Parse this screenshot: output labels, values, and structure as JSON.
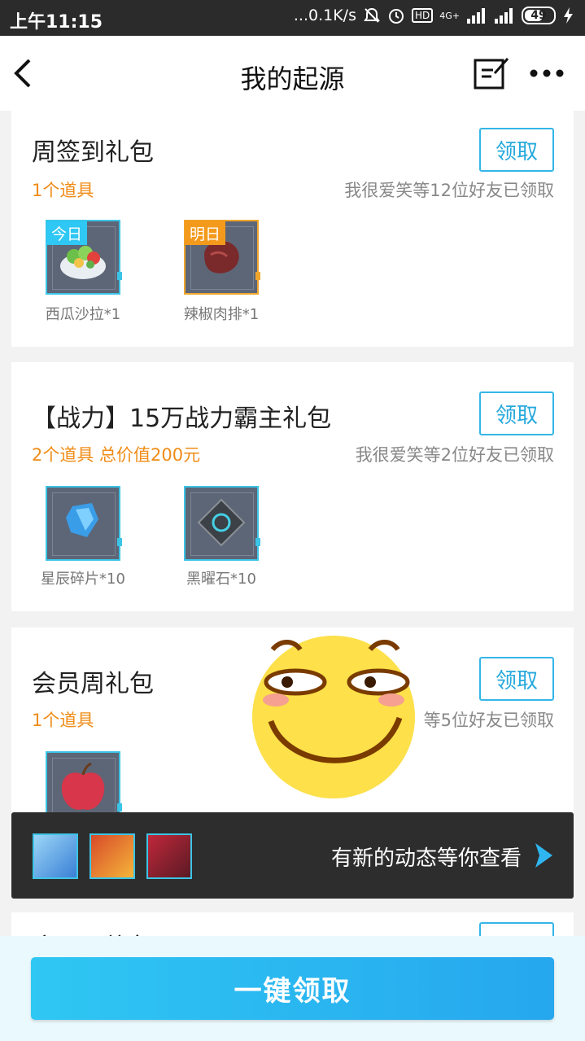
{
  "status_bar": {
    "time": "上午11:15",
    "network_speed": "...0.1K/s",
    "hd_label": "HD",
    "signal_label": "4G+",
    "battery": "49"
  },
  "app_bar": {
    "title": "我的起源"
  },
  "gift_packs": [
    {
      "title": "周签到礼包",
      "items_text": "1个道具",
      "friends_text": "我很爱笑等12位好友已领取",
      "claim_label": "领取",
      "items": [
        {
          "tag": "今日",
          "label": "西瓜沙拉*1"
        },
        {
          "tag": "明日",
          "label": "辣椒肉排*1"
        }
      ]
    },
    {
      "title": "【战力】15万战力霸主礼包",
      "items_text": "2个道具 总价值200元",
      "friends_text": "我很爱笑等2位好友已领取",
      "claim_label": "领取",
      "items": [
        {
          "label": "星辰碎片*10"
        },
        {
          "label": "黑曜石*10"
        }
      ]
    },
    {
      "title": "会员周礼包",
      "items_text": "1个道具",
      "friends_text": "等5位好友已领取",
      "claim_label": "领取",
      "items": [
        {}
      ]
    },
    {
      "title": "会员日礼包"
    }
  ],
  "activity_banner": {
    "text": "有新的动态等你查看"
  },
  "one_key_claim_label": "一键领取",
  "colors": {
    "accent_blue": "#35b6e8",
    "orange": "#f08c17",
    "status_bar_bg": "#2b2b2b"
  }
}
